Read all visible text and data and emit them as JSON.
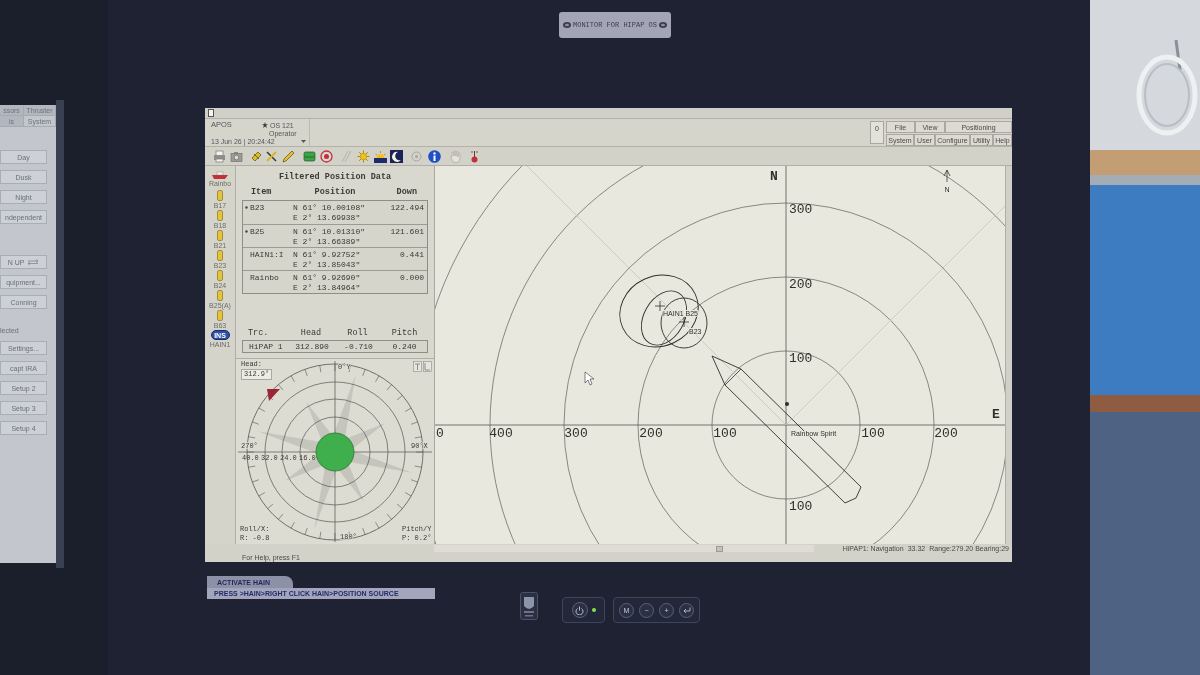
{
  "label_plate": {
    "text": "MONITOR FOR HIPAP OS"
  },
  "side_monitor": {
    "tab_rows": [
      [
        {
          "label": "ssors",
          "selected": false
        },
        {
          "label": "Thruster",
          "selected": false
        }
      ],
      [
        {
          "label": "ls",
          "selected": false
        },
        {
          "label": "System",
          "selected": true
        }
      ]
    ],
    "groups": [
      {
        "buttons": [
          {
            "kind": "plain",
            "label": "Day"
          },
          {
            "kind": "plain",
            "label": "Dusk"
          },
          {
            "kind": "plain",
            "label": "Night"
          },
          {
            "kind": "plain",
            "label": "ndependent"
          }
        ]
      },
      {
        "buttons": [
          {
            "kind": "arrows",
            "label": "N UP"
          },
          {
            "kind": "plain",
            "label": "quipment..."
          },
          {
            "kind": "plain",
            "label": "Conning"
          }
        ]
      },
      {
        "heading": "lected",
        "buttons": [
          {
            "kind": "plain",
            "label": "Settings..."
          },
          {
            "kind": "plain",
            "label": "capt IRA"
          },
          {
            "kind": "plain",
            "label": "Setup 2"
          },
          {
            "kind": "plain",
            "label": "Setup 3"
          },
          {
            "kind": "plain",
            "label": "Setup 4"
          }
        ]
      }
    ]
  },
  "window": {
    "app": "APOS",
    "datetime": "13 Jun 26 | 20:24:42",
    "station": "OS 121",
    "role": "Operator",
    "alarm_count": "0",
    "menu_rows": [
      [
        "File",
        "View",
        "Positioning"
      ],
      [
        "System",
        "User",
        "Configure",
        "Utility",
        "Help"
      ]
    ]
  },
  "sources": [
    {
      "kind": "vessel",
      "label": "Rainbo"
    },
    {
      "kind": "transponder",
      "label": "B17"
    },
    {
      "kind": "transponder",
      "label": "B18"
    },
    {
      "kind": "transponder",
      "label": "B21"
    },
    {
      "kind": "transponder",
      "label": "B23"
    },
    {
      "kind": "transponder",
      "label": "B24"
    },
    {
      "kind": "transponder",
      "label": "B25(A)"
    },
    {
      "kind": "transponder",
      "label": "B63"
    },
    {
      "kind": "ins",
      "badge": "INS",
      "label": "HAIN1"
    }
  ],
  "position_data": {
    "title": "Filtered Position Data",
    "columns": [
      "Item",
      "Position",
      "Down"
    ],
    "rows": [
      {
        "marked": true,
        "item": "B23",
        "north": "N 61° 10.00108\"",
        "east": "E 2° 13.69938\"",
        "down": "122.494"
      },
      {
        "marked": true,
        "item": "B25",
        "north": "N 61° 10.01310\"",
        "east": "E 2° 13.66389\"",
        "down": "121.601"
      },
      {
        "marked": false,
        "item": "HAIN1:I",
        "north": "N 61° 9.92752\"",
        "east": "E 2° 13.85043\"",
        "down": "0.441"
      },
      {
        "marked": false,
        "item": "Rainbo",
        "north": "N 61° 9.92690\"",
        "east": "E 2° 13.84964\"",
        "down": "0.000"
      }
    ]
  },
  "attitude": {
    "columns": [
      "Trc.",
      "Head",
      "Roll",
      "Pitch"
    ],
    "values": [
      "HiPAP 1",
      "312.890",
      "-0.710",
      "0.240"
    ]
  },
  "compass": {
    "head_label": "Head:",
    "head": "312.9°",
    "top": "0°Y",
    "right": "90°X",
    "bottom": "180°",
    "left": "270°",
    "scale": [
      "40.0",
      "32.0",
      "24.0",
      "16.0"
    ],
    "roll_label": "Roll/X:",
    "roll": "R: -0.8",
    "pitch_label": "Pitch/Y",
    "pitch": "P: 0.2°"
  },
  "plot": {
    "north": "N",
    "east": "E",
    "north_ranges": [
      "300",
      "200",
      "100"
    ],
    "south_ranges": [
      "100"
    ],
    "west_ranges": [
      "0",
      "400",
      "300",
      "200",
      "100"
    ],
    "east_ranges": [
      "100",
      "200"
    ],
    "targets": [
      {
        "label": "HAIN1 B25"
      },
      {
        "label": "B23"
      }
    ],
    "vessel": "Rainbow Spirit",
    "compass_mark": "N"
  },
  "status_bar": {
    "mode": "HiPAP1: Navigation",
    "value": "33.32",
    "range": "Range:279.20 Bearing:29",
    "help": "For Help, press F1"
  },
  "hint": {
    "title": "ACTIVATE HAIN",
    "text": "PRESS >HAIN>RIGHT CLICK HAIN>POSITION SOURCE"
  },
  "bezel": {
    "power_on": true,
    "keys": [
      "M",
      "−",
      "+"
    ]
  }
}
